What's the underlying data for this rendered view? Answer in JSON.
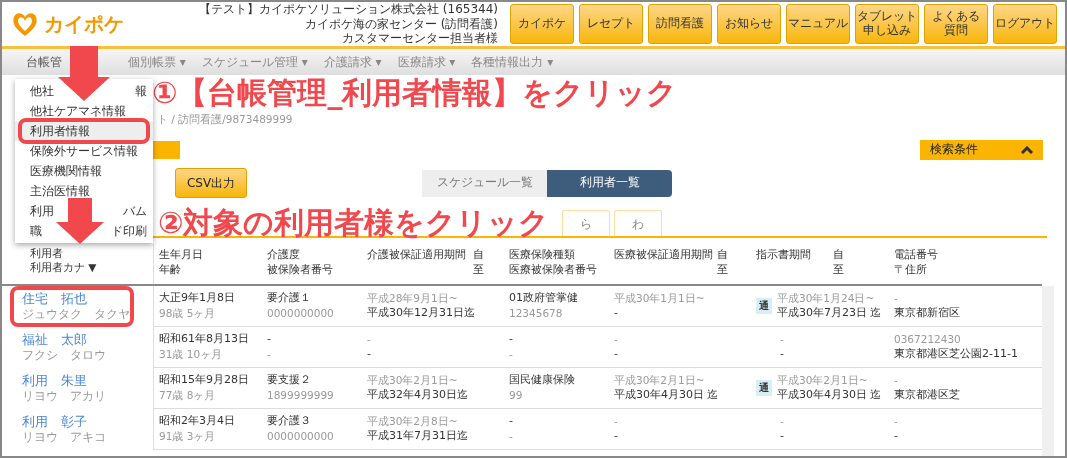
{
  "header": {
    "logo_text": "カイポケ",
    "account_lines": [
      "【テスト】カイポケソリューション株式会社 (165344)",
      "カイポケ海の家センター (訪問看護)",
      "カスタマーセンター担当者様"
    ],
    "buttons": [
      {
        "lines": [
          "カイポケ"
        ]
      },
      {
        "lines": [
          "レセプト"
        ]
      },
      {
        "lines": [
          "訪問看護"
        ]
      },
      {
        "lines": [
          "お知らせ"
        ]
      },
      {
        "lines": [
          "マニュアル"
        ]
      },
      {
        "lines": [
          "タブレット",
          "申し込み"
        ]
      },
      {
        "lines": [
          "よくある",
          "質問"
        ]
      },
      {
        "lines": [
          "ログアウト"
        ]
      }
    ]
  },
  "nav": [
    {
      "label": "台帳管"
    },
    {
      "label": "個別帳票 ▾"
    },
    {
      "label": "スケジュール管理 ▾"
    },
    {
      "label": "介護請求 ▾"
    },
    {
      "label": "医療請求 ▾"
    },
    {
      "label": "各種情報出力 ▾"
    }
  ],
  "dropdown": [
    {
      "parts": [
        "他社",
        "報"
      ],
      "selected": false
    },
    {
      "parts": [
        "他社ケアマネ情報"
      ],
      "selected": false
    },
    {
      "parts": [
        "利用者情報"
      ],
      "selected": true
    },
    {
      "parts": [
        "保険外サービス情報"
      ],
      "selected": false
    },
    {
      "parts": [
        "医療機関情報"
      ],
      "selected": false
    },
    {
      "parts": [
        "主治医情報"
      ],
      "selected": false
    },
    {
      "parts": [
        "利用",
        "バム"
      ],
      "selected": false
    },
    {
      "parts": [
        "職",
        "ド印刷"
      ],
      "selected": false
    }
  ],
  "breadcrumb": [
    "ト / 訪問看護/9873489999"
  ],
  "search_toggle": {
    "label": "検索条件",
    "expanded": true
  },
  "csv_button": "CSV出力",
  "view_tabs": [
    {
      "label": "スケジュール一覧",
      "selected": false
    },
    {
      "label": "利用者一覧",
      "selected": true
    }
  ],
  "kana_tabs": [
    {
      "label": "ら",
      "selected": false
    },
    {
      "label": "わ",
      "selected": false
    }
  ],
  "annotations": [
    {
      "text": "①【台帳管理_利用者情報】をクリック"
    },
    {
      "text": "②対象の利用者様をクリック"
    }
  ],
  "table": {
    "name_header": [
      "利用者",
      "利用者カナ ▼"
    ],
    "columns": [
      {
        "lines": [
          "生年月日",
          "年齢"
        ]
      },
      {
        "lines": [
          "介護度",
          "被保険者番号"
        ]
      },
      {
        "lines": [
          "介護被保証適用期間"
        ],
        "range": [
          "自",
          "至"
        ]
      },
      {
        "lines": [
          "医療保険種類",
          "医療被保険者番号"
        ]
      },
      {
        "lines": [
          "医療被保証適用期間"
        ],
        "range": [
          "自",
          "至"
        ]
      },
      {
        "lines": [
          "指示書期間"
        ],
        "range": [
          "自",
          "至"
        ]
      },
      {
        "lines": [
          "電話番号",
          "〒住所"
        ]
      }
    ],
    "rows": [
      {
        "name": "住宅　拓也",
        "kana": "ジュウタク　タクヤ",
        "highlighted": true,
        "badge": "通",
        "cells": [
          {
            "lines": [
              "大正9年1月8日",
              "98歳 5ヶ月"
            ]
          },
          {
            "lines": [
              "要介護１",
              "0000000000"
            ]
          },
          {
            "lines": [
              "平成28年9月1日~",
              "平成30年12月31日迄"
            ]
          },
          {
            "lines": [
              "01政府管掌健",
              "12345678"
            ]
          },
          {
            "lines": [
              "平成30年1月1日~",
              "-"
            ]
          },
          {
            "lines": [
              "平成30年1月24日~",
              "平成30年7月23日 迄"
            ]
          },
          {
            "lines": [
              "-",
              "東京都新宿区"
            ]
          }
        ]
      },
      {
        "name": "福祉　太郎",
        "kana": "フクシ　タロウ",
        "highlighted": false,
        "cells": [
          {
            "lines": [
              "昭和61年8月13日",
              "31歳 10ヶ月"
            ]
          },
          {
            "lines": [
              "-",
              "-"
            ]
          },
          {
            "lines": [
              "-",
              "-"
            ]
          },
          {
            "lines": [
              "-",
              "-"
            ]
          },
          {
            "lines": [
              "-",
              "-"
            ]
          },
          {
            "lines": [
              "-",
              "-"
            ]
          },
          {
            "lines": [
              "0367212430",
              "東京都港区芝公園2-11-1"
            ]
          }
        ]
      },
      {
        "name": "利用　朱里",
        "kana": "リヨウ　アカリ",
        "highlighted": false,
        "badge": "通",
        "cells": [
          {
            "lines": [
              "昭和15年9月28日",
              "77歳 8ヶ月"
            ]
          },
          {
            "lines": [
              "要支援２",
              "1899999999"
            ]
          },
          {
            "lines": [
              "平成30年2月1日~",
              "平成32年4月30日迄"
            ]
          },
          {
            "lines": [
              "国民健康保険",
              "99"
            ]
          },
          {
            "lines": [
              "平成30年2月1日~",
              "平成30年4月30日 迄"
            ]
          },
          {
            "lines": [
              "平成30年2月1日~",
              "平成30年4月30日 迄"
            ]
          },
          {
            "lines": [
              "-",
              "東京都港区芝"
            ]
          }
        ]
      },
      {
        "name": "利用　彰子",
        "kana": "リヨウ　アキコ",
        "highlighted": false,
        "cells": [
          {
            "lines": [
              "昭和2年3月4日",
              "91歳 3ヶ月"
            ]
          },
          {
            "lines": [
              "要介護３",
              "0000000000"
            ]
          },
          {
            "lines": [
              "平成30年2月8日~",
              "平成31年7月31日迄"
            ]
          },
          {
            "lines": [
              "-",
              "-"
            ]
          },
          {
            "lines": [
              "-",
              "-"
            ]
          },
          {
            "lines": [
              "-",
              "-"
            ]
          },
          {
            "lines": [
              "-",
              "-"
            ]
          }
        ]
      }
    ]
  }
}
